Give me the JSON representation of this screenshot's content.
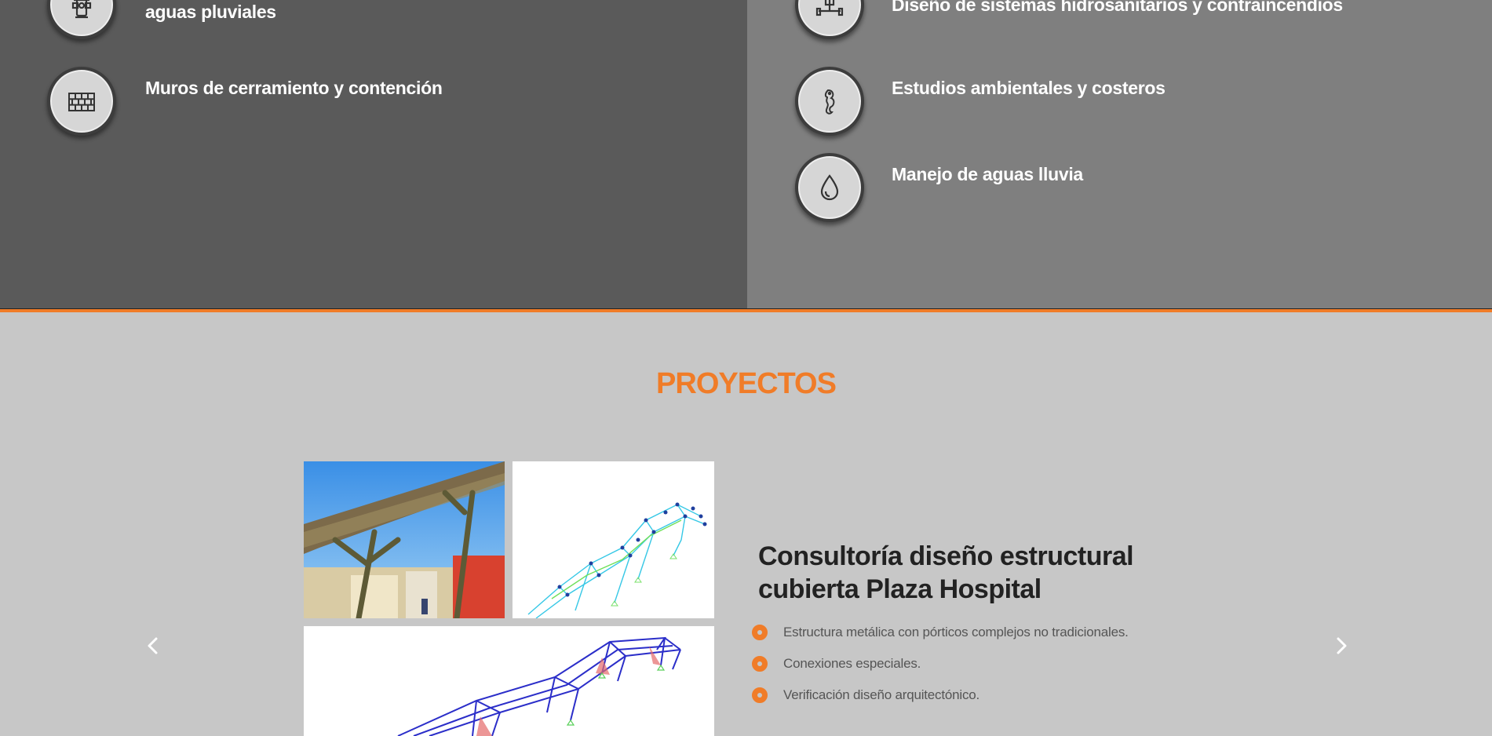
{
  "services": {
    "left": [
      {
        "label": "aguas pluviales",
        "icon": "fire-hydrant-icon"
      },
      {
        "label": "Muros de cerramiento y contención",
        "icon": "brick-wall-icon"
      }
    ],
    "right": [
      {
        "label": "Diseño de sistemas hidrosanitarios y contraincendios",
        "icon": "pipe-valve-icon"
      },
      {
        "label": "Estudios ambientales y costeros",
        "icon": "seahorse-icon"
      },
      {
        "label": "Manejo de aguas lluvia",
        "icon": "water-drop-icon"
      }
    ]
  },
  "projects": {
    "section_title": "PROYECTOS",
    "current": {
      "title": "Consultoría diseño estructural cubierta Plaza Hospital",
      "bullets": [
        "Estructura metálica con pórticos complejos no tradicionales.",
        "Conexiones especiales.",
        "Verificación diseño arquitectónico."
      ]
    },
    "carousel": {
      "prev_icon": "chevron-left-icon",
      "next_icon": "chevron-right-icon"
    }
  },
  "colors": {
    "accent": "#f07c28",
    "left_panel": "#5a5a5a",
    "right_panel": "#7f7f7f",
    "background": "#c7c7c7"
  }
}
